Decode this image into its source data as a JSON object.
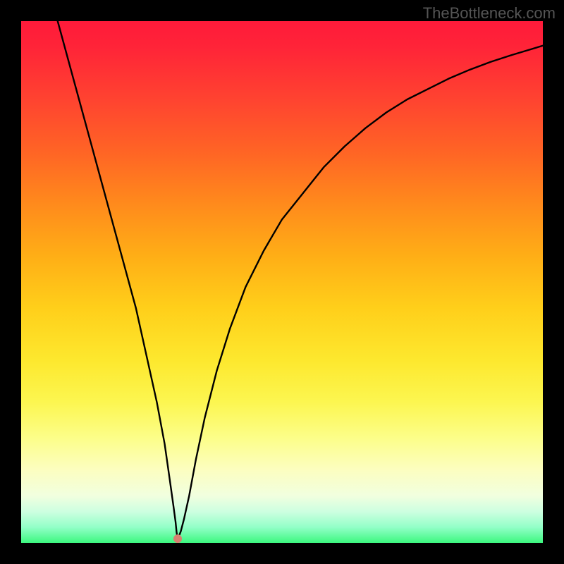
{
  "watermark": "TheBottleneck.com",
  "chart_data": {
    "type": "line",
    "title": "",
    "xlabel": "",
    "ylabel": "",
    "xlim": [
      0,
      100
    ],
    "ylim": [
      0,
      100
    ],
    "grid": false,
    "legend": false,
    "series": [
      {
        "name": "curve",
        "x": [
          7,
          10,
          13,
          16,
          19,
          22,
          24,
          26,
          27.5,
          28.5,
          29.2,
          29.6,
          29.8,
          30,
          30.2,
          30.6,
          31.2,
          32.2,
          33.5,
          35.2,
          37.5,
          40,
          43,
          46.5,
          50,
          54,
          58,
          62,
          66,
          70,
          74,
          78,
          82,
          86,
          90,
          94,
          98,
          100
        ],
        "y": [
          100,
          89,
          78,
          67,
          56,
          45,
          36,
          27,
          19,
          12,
          7,
          4,
          2,
          0.8,
          1.2,
          2.2,
          4.5,
          9,
          16,
          24,
          33,
          41,
          49,
          56,
          62,
          67,
          72,
          76,
          79.5,
          82.5,
          85,
          87,
          89,
          90.7,
          92.2,
          93.5,
          94.7,
          95.3
        ]
      }
    ],
    "marker": {
      "x": 30,
      "y": 0.8,
      "color": "#d88070"
    },
    "gradient_stops": [
      {
        "pos": 0,
        "color": "#ff1a3a"
      },
      {
        "pos": 50,
        "color": "#ffcf1a"
      },
      {
        "pos": 80,
        "color": "#fcfe8a"
      },
      {
        "pos": 100,
        "color": "#3cf87f"
      }
    ]
  }
}
